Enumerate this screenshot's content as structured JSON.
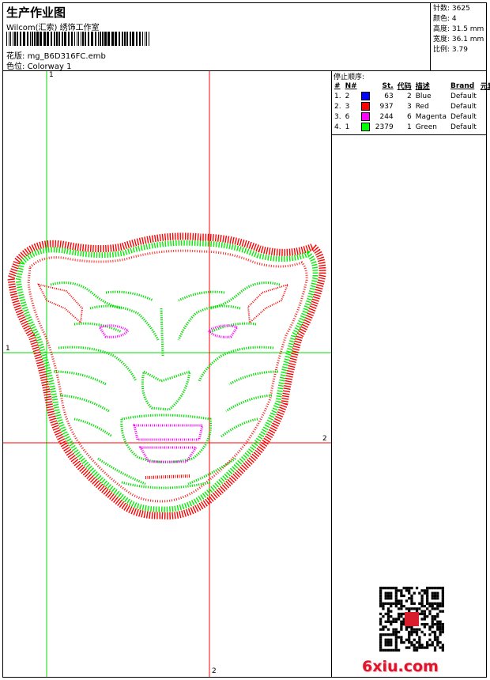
{
  "header": {
    "title": "生产作业图",
    "company": "Wilcom(汇索) 绣饰工作室",
    "design_label": "花版:",
    "design_name": "mg_B6D316FC.emb",
    "colorway_label": "色位:",
    "colorway_name": "Colorway 1"
  },
  "stats": {
    "stitches": "针数: 3625",
    "colors": "颜色: 4",
    "height": "高度: 31.5 mm",
    "width": "宽度: 36.1 mm",
    "scale": "比例: 3.79"
  },
  "stop_sequence": {
    "title": "停止顺序:",
    "columns": [
      "#",
      "N#",
      "St.",
      "代码",
      "描述",
      "Brand",
      "元素"
    ],
    "rows": [
      {
        "index": "1.",
        "needle": "2",
        "stitches": "63",
        "code": "2",
        "description": "Blue",
        "brand": "Default",
        "color": "#0000ff"
      },
      {
        "index": "2.",
        "needle": "3",
        "stitches": "937",
        "code": "3",
        "description": "Red",
        "brand": "Default",
        "color": "#ff0000"
      },
      {
        "index": "3.",
        "needle": "6",
        "stitches": "244",
        "code": "6",
        "description": "Magenta",
        "brand": "Default",
        "color": "#ff00ff"
      },
      {
        "index": "4.",
        "needle": "1",
        "stitches": "2379",
        "code": "1",
        "description": "Green",
        "brand": "Default",
        "color": "#00ff00"
      }
    ]
  },
  "canvas": {
    "guide_green_color": "#00dd00",
    "guide_red_color": "#ff0000",
    "markers": {
      "green_top": "1",
      "green_left": "1",
      "red_right": "2",
      "red_bottom": "2"
    }
  },
  "watermark": "6xiu.com"
}
